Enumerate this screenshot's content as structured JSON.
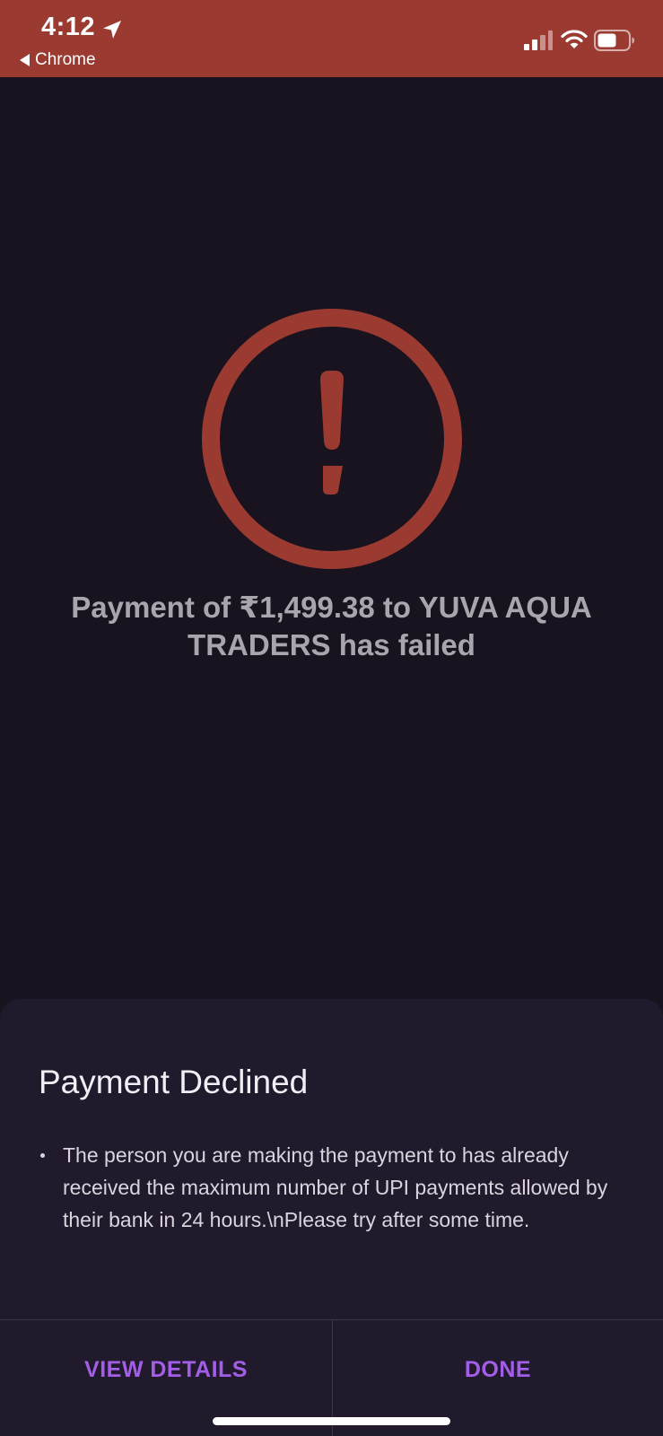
{
  "status_bar": {
    "time": "4:12",
    "back_app_label": "Chrome",
    "background_color": "#9a3a31",
    "icons": [
      "location-arrow-icon",
      "cellular-signal-icon",
      "wifi-icon",
      "battery-icon"
    ]
  },
  "main": {
    "status_icon": "exclamation-circle-icon",
    "accent_color": "#9a3a31",
    "message": "Payment of ₹1,499.38 to YUVA AQUA TRADERS has failed"
  },
  "sheet": {
    "title": "Payment Declined",
    "reasons": [
      "The person you are making the payment to has already received the maximum number of UPI payments allowed by their bank in 24 hours.\\nPlease try after some time."
    ],
    "actions": {
      "view_details_label": "VIEW DETAILS",
      "done_label": "DONE"
    },
    "action_color": "#a35ee8"
  }
}
